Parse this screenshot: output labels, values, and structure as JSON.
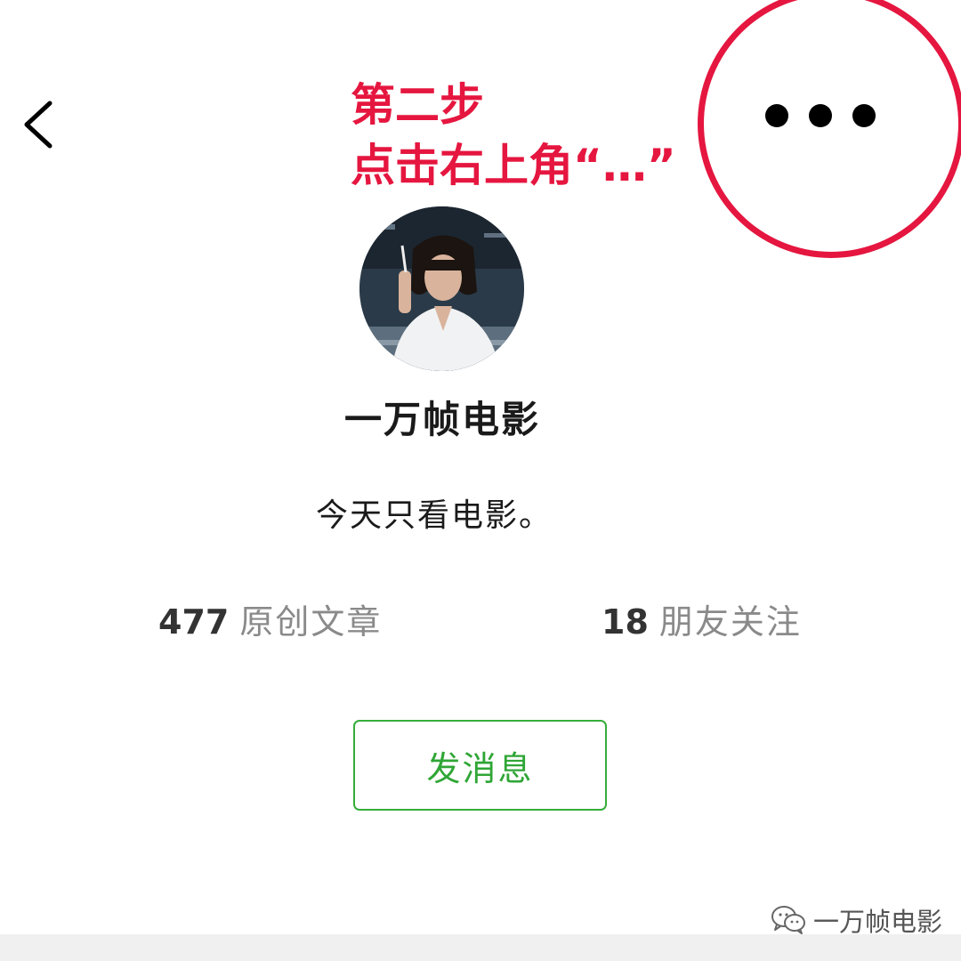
{
  "annotation": {
    "line1": "第二步",
    "line2": "点击右上角“…”",
    "color": "#e5163f"
  },
  "nav": {
    "back_icon": "chevron-left-icon",
    "more_icon": "more-dots-icon"
  },
  "profile": {
    "name": "一万帧电影",
    "signature": "今天只看电影。"
  },
  "stats": {
    "articles_count": "477",
    "articles_label": "原创文章",
    "friends_count": "18",
    "friends_label": "朋友关注"
  },
  "actions": {
    "message_label": "发消息",
    "accent_color": "#36ad3b"
  },
  "watermark": {
    "text": "一万帧电影",
    "icon": "wechat-icon"
  }
}
